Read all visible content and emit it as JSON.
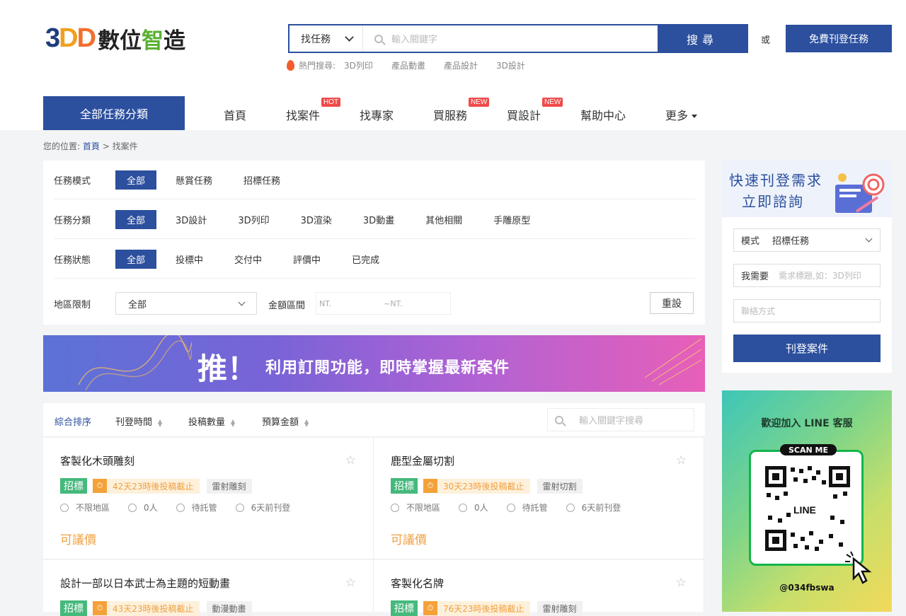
{
  "header": {
    "logo_3": "3",
    "logo_d1": "D",
    "logo_d2": "D",
    "logo_a": "數位",
    "logo_b": "智",
    "logo_c": "造",
    "search_select": "找任務",
    "search_placeholder": "輸入關鍵字",
    "search_button": "搜尋",
    "or": "或",
    "post_button": "免費刊登任務",
    "hot_label": "熱門搜尋:",
    "hot_keywords": [
      "3D列印",
      "產品動畫",
      "產品設計",
      "3D設計"
    ]
  },
  "nav": {
    "all_categories": "全部任務分類",
    "items": [
      {
        "label": "首頁",
        "tag": ""
      },
      {
        "label": "找案件",
        "tag": "HOT"
      },
      {
        "label": "找專家",
        "tag": ""
      },
      {
        "label": "買服務",
        "tag": "NEW"
      },
      {
        "label": "買設計",
        "tag": "NEW"
      },
      {
        "label": "幫助中心",
        "tag": ""
      },
      {
        "label": "更多",
        "tag": ""
      }
    ]
  },
  "breadcrumb": {
    "prefix": "您的位置:",
    "home": "首頁",
    "sep": ">",
    "current": "找案件"
  },
  "filters": {
    "mode": {
      "label": "任務模式",
      "options": [
        "全部",
        "懸賞任務",
        "招標任務"
      ]
    },
    "category": {
      "label": "任務分類",
      "options": [
        "全部",
        "3D設計",
        "3D列印",
        "3D渲染",
        "3D動畫",
        "其他相關",
        "手雕原型"
      ]
    },
    "status": {
      "label": "任務狀態",
      "options": [
        "全部",
        "投標中",
        "交付中",
        "評價中",
        "已完成"
      ]
    },
    "region": {
      "label": "地區限制",
      "value": "全部"
    },
    "amount": {
      "label": "金額區間",
      "from": "NT.",
      "to": "~NT."
    },
    "reset": "重設"
  },
  "banner": {
    "big": "推！",
    "text": "利用訂閱功能，即時掌握最新案件"
  },
  "sortbar": {
    "items": [
      "綜合排序",
      "刊登時間",
      "投稿數量",
      "預算金額"
    ],
    "search_placeholder": "輸入關鍵字搜尋"
  },
  "cards": [
    {
      "title": "客製化木頭雕刻",
      "type": "招標",
      "deadline": "42天23時後投稿截止",
      "category": "雷射雕刻",
      "region": "不限地區",
      "people": "0人",
      "escrow": "待託管",
      "posted": "6天前刊登",
      "price": "可議價"
    },
    {
      "title": "鹿型金屬切割",
      "type": "招標",
      "deadline": "30天23時後投稿截止",
      "category": "雷射切割",
      "region": "不限地區",
      "people": "0人",
      "escrow": "待託管",
      "posted": "6天前刊登",
      "price": "可議價"
    },
    {
      "title": "設計一部以日本武士為主題的短動畫",
      "type": "招標",
      "deadline": "43天23時後投稿截止",
      "category": "動漫動畫"
    },
    {
      "title": "客製化名牌",
      "type": "招標",
      "deadline": "76天23時後投稿截止",
      "category": "雷射雕刻"
    }
  ],
  "side_form": {
    "title1": "快速刊登需求",
    "title2": "立即諮詢",
    "mode_label": "模式",
    "mode_value": "招標任務",
    "need_label": "我需要",
    "need_placeholder": "需求標題,如：3D列印",
    "contact_placeholder": "聯絡方式",
    "submit": "刊登案件"
  },
  "line_ad": {
    "title": "歡迎加入 LINE 客服",
    "scan": "SCAN ME",
    "qr_label": "LINE",
    "handle": "@034fbswa"
  },
  "colors": {
    "brand": "#2c4f9e",
    "hot_tag": "#f04a4a",
    "green": "#45b97c",
    "orange": "#f0a040"
  }
}
